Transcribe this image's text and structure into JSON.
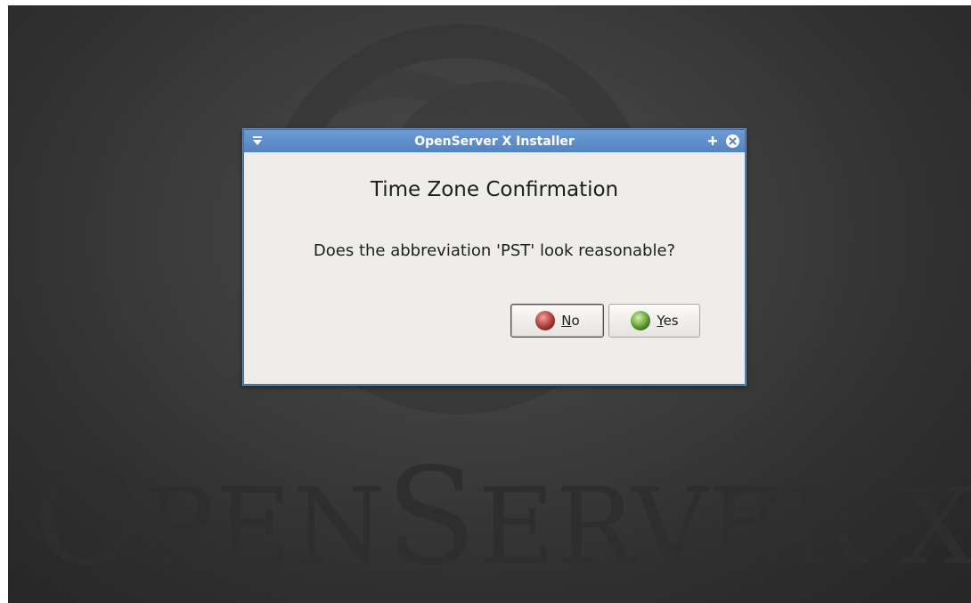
{
  "background": {
    "wordmark_prefix": "O",
    "wordmark_middle": "PEN",
    "wordmark_s": "S",
    "wordmark_rest": "ERVER X"
  },
  "window": {
    "title": "OpenServer X Installer",
    "menu_icon": "window-menu-icon",
    "add_icon": "plus-icon",
    "close_icon": "close-icon",
    "titlebar_color": "#5e8cc9"
  },
  "dialog": {
    "heading": "Time Zone Confirmation",
    "message": "Does the abbreviation 'PST' look reasonable?",
    "buttons": {
      "no": {
        "mnemonic": "N",
        "rest": "o",
        "icon": "red-orb-icon",
        "color": "#c0504d"
      },
      "yes": {
        "mnemonic": "Y",
        "rest": "es",
        "icon": "green-orb-icon",
        "color": "#7ab648"
      }
    }
  }
}
